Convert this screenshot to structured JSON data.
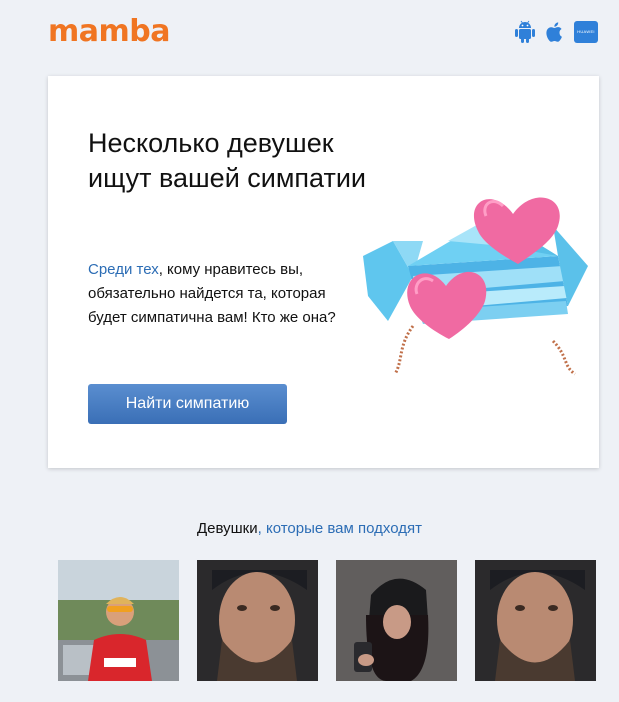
{
  "header": {
    "logo": "mamba",
    "store_icons": [
      "android-icon",
      "apple-icon",
      "huawei-icon"
    ],
    "huawei_label": "HUAWEI"
  },
  "card": {
    "title": "Несколько девушек ищут вашей симпатии",
    "text_accent": "Среди тех",
    "text_rest": ", кому нравитесь вы, обязательно найдется та, которая будет симпатична вам! Кто же она?",
    "button_label": "Найти симпатию"
  },
  "suggestions": {
    "title_part1": "Девушки",
    "title_part2": ", которые вам подходят",
    "photos": [
      "photo-1",
      "photo-2",
      "photo-3",
      "photo-4"
    ]
  },
  "colors": {
    "logo": "#f07522",
    "accent_link": "#2c6db5",
    "button": "#4a7fc4",
    "background": "#eef1f6"
  }
}
